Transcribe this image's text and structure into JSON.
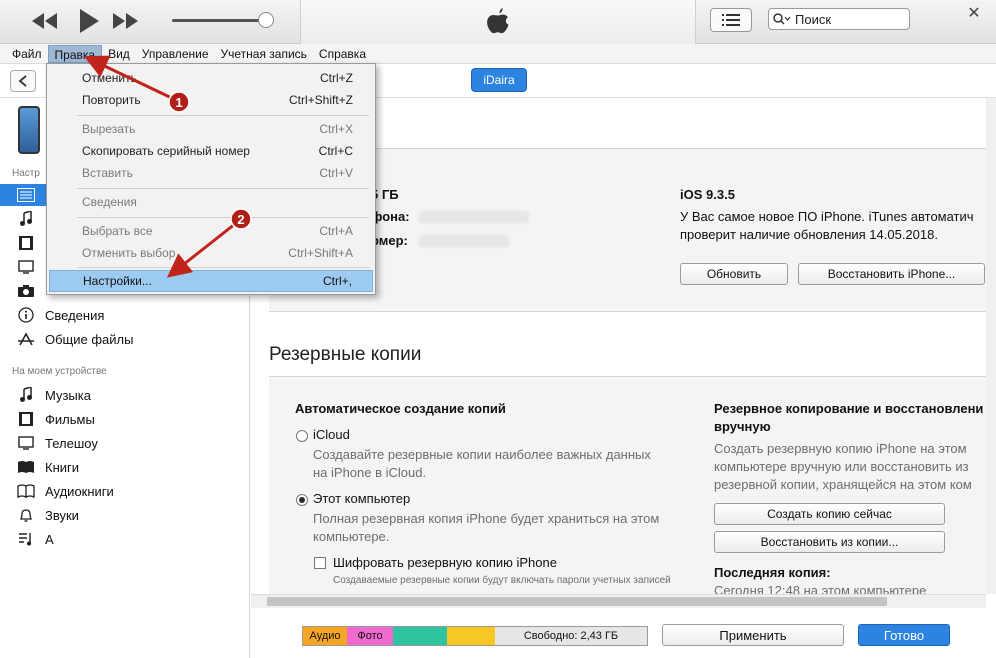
{
  "toolbar": {
    "search_placeholder": "Поиск"
  },
  "menubar": {
    "items": [
      "Файл",
      "Правка",
      "Вид",
      "Управление",
      "Учетная запись",
      "Справка"
    ]
  },
  "device_name": "iDaira",
  "dropdown": {
    "items": [
      {
        "label": "Отменить",
        "shortcut": "Ctrl+Z"
      },
      {
        "label": "Повторить",
        "shortcut": "Ctrl+Shift+Z"
      },
      {
        "label": "Вырезать",
        "shortcut": "Ctrl+X"
      },
      {
        "label": "Скопировать серийный номер",
        "shortcut": "Ctrl+C"
      },
      {
        "label": "Вставить",
        "shortcut": "Ctrl+V"
      },
      {
        "label": "Сведения",
        "shortcut": ""
      },
      {
        "label": "Выбрать все",
        "shortcut": "Ctrl+A"
      },
      {
        "label": "Отменить выбор",
        "shortcut": "Ctrl+Shift+A"
      },
      {
        "label": "Настройки...",
        "shortcut": "Ctrl+,"
      }
    ]
  },
  "annotations": [
    "1",
    "2"
  ],
  "sidebar": {
    "section1_label": "Настр",
    "info_label": "Сведения",
    "shared_files_label": "Общие файлы",
    "section2_label": "На моем устройстве",
    "device_items": [
      "Музыка",
      "Фильмы",
      "Телешоу",
      "Книги",
      "Аудиокниги",
      "Звуки",
      "А"
    ]
  },
  "summary": {
    "capacity_partial": "5 ГБ",
    "phone_partial": "фона:",
    "serial_partial": "омер:",
    "ios_version": "iOS 9.3.5",
    "ios_line1": "У Вас самое новое ПО iPhone. iTunes автоматич",
    "ios_line2": "проверит наличие обновления 14.05.2018.",
    "update_button": "Обновить",
    "restore_button": "Восстановить iPhone..."
  },
  "backups": {
    "title": "Резервные копии",
    "auto_heading": "Автоматическое создание копий",
    "icloud_label": "iCloud",
    "icloud_desc1": "Создавайте резервные копии наиболее важных данных",
    "icloud_desc2": "на iPhone в iCloud.",
    "computer_label": "Этот компьютер",
    "computer_desc1": "Полная резервная копия iPhone будет храниться на этом",
    "computer_desc2": "компьютере.",
    "encrypt_label": "Шифровать резервную копию iPhone",
    "encrypt_desc": "Создаваемые резервные копии будут включать пароли учетных записей",
    "manual_heading1": "Резервное копирование и восстановлени",
    "manual_heading2": "вручную",
    "manual_desc1": "Создать резервную копию iPhone на этом",
    "manual_desc2": "компьютере вручную или восстановить из",
    "manual_desc3": "резервной копии, хранящейся на этом ком",
    "backup_now_button": "Создать копию сейчас",
    "restore_backup_button": "Восстановить из копии...",
    "last_backup_label": "Последняя копия:",
    "last_backup_value": "Сегодня 12:48 на этом компьютере"
  },
  "capacity_bar": {
    "audio_label": "Аудио",
    "photo_label": "Фото",
    "free_label": "Свободно: 2,43 ГБ",
    "colors": {
      "audio": "#f5a623",
      "photo": "#f06ad0",
      "apps": "#2ec4a0",
      "other": "#f7c825",
      "free": "#e6e6e6"
    }
  },
  "bottom": {
    "apply_button": "Применить",
    "done_button": "Готово"
  },
  "accent_color": "#2d84e0"
}
